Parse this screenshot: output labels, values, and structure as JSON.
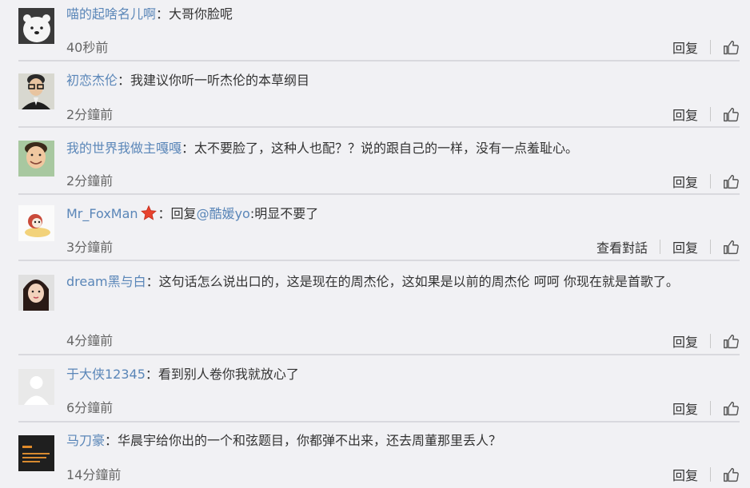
{
  "reply_label": "回复",
  "view_dialog_label": "查看對話",
  "comments": [
    {
      "user": "喵的起啥名儿啊",
      "sep": "：",
      "text": "大哥你脸呢",
      "time": "40秒前",
      "avatar": "polar-bear"
    },
    {
      "user": "初恋杰伦",
      "sep": "：",
      "text": "我建议你听一听杰伦的本草纲目",
      "time": "2分鐘前",
      "avatar": "man-glasses"
    },
    {
      "user": "我的世界我做主嘎嘎",
      "sep": "：",
      "text": "太不要脸了，这种人也配？？说的跟自己的一样，没有一点羞耻心。",
      "time": "2分鐘前",
      "avatar": "boy-smiling"
    },
    {
      "user": "Mr_FoxMan",
      "sep": "：",
      "reply_prefix": "回复",
      "mention": "@酷媛yo",
      "text": ":明显不要了",
      "time": "3分鐘前",
      "avatar": "cartoon-dog"
    },
    {
      "user": "dream黑与白",
      "sep": "：",
      "text": "这句话怎么说出口的，这是现在的周杰伦，这如果是以前的周杰伦 呵呵 你现在就是首歌了。",
      "time": "4分鐘前",
      "avatar": "girl-selfie"
    },
    {
      "user": "于大侠12345",
      "sep": "：",
      "text": "看到别人卷你我就放心了",
      "time": "6分鐘前",
      "avatar": "default-user"
    },
    {
      "user": "马刀豪",
      "sep": "：",
      "text": "华晨宇给你出的一个和弦题目，你都弹不出来，还去周董那里丢人？",
      "time": "14分鐘前",
      "avatar": "dark-card"
    }
  ]
}
